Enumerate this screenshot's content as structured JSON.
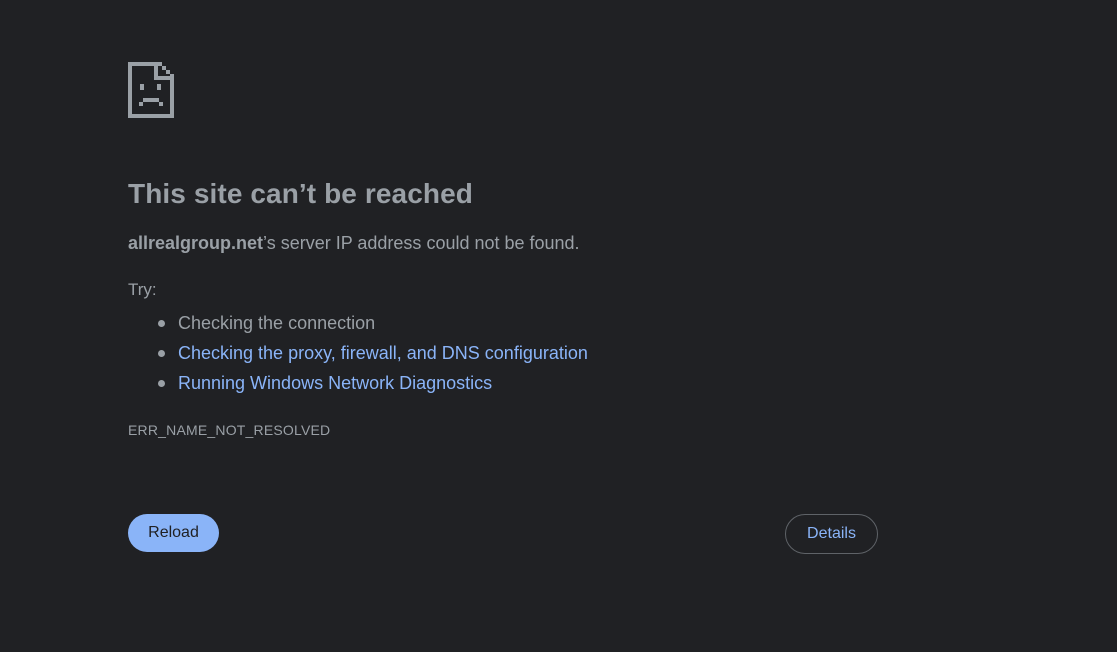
{
  "error_page": {
    "icon": "sad-document-icon",
    "title": "This site can’t be reached",
    "host": "allrealgroup.net",
    "summary_suffix": "’s server IP address could not be found.",
    "try_label": "Try:",
    "suggestions": [
      {
        "text": "Checking the connection",
        "link": false
      },
      {
        "text": "Checking the proxy, firewall, and DNS configuration",
        "link": true
      },
      {
        "text": "Running Windows Network Diagnostics",
        "link": true
      }
    ],
    "error_code": "ERR_NAME_NOT_RESOLVED",
    "reload_label": "Reload",
    "details_label": "Details"
  },
  "colors": {
    "background": "#202124",
    "text": "#9aa0a6",
    "link": "#8ab4f8",
    "primary_button": "#8ab4f8",
    "border": "#5f6368"
  }
}
